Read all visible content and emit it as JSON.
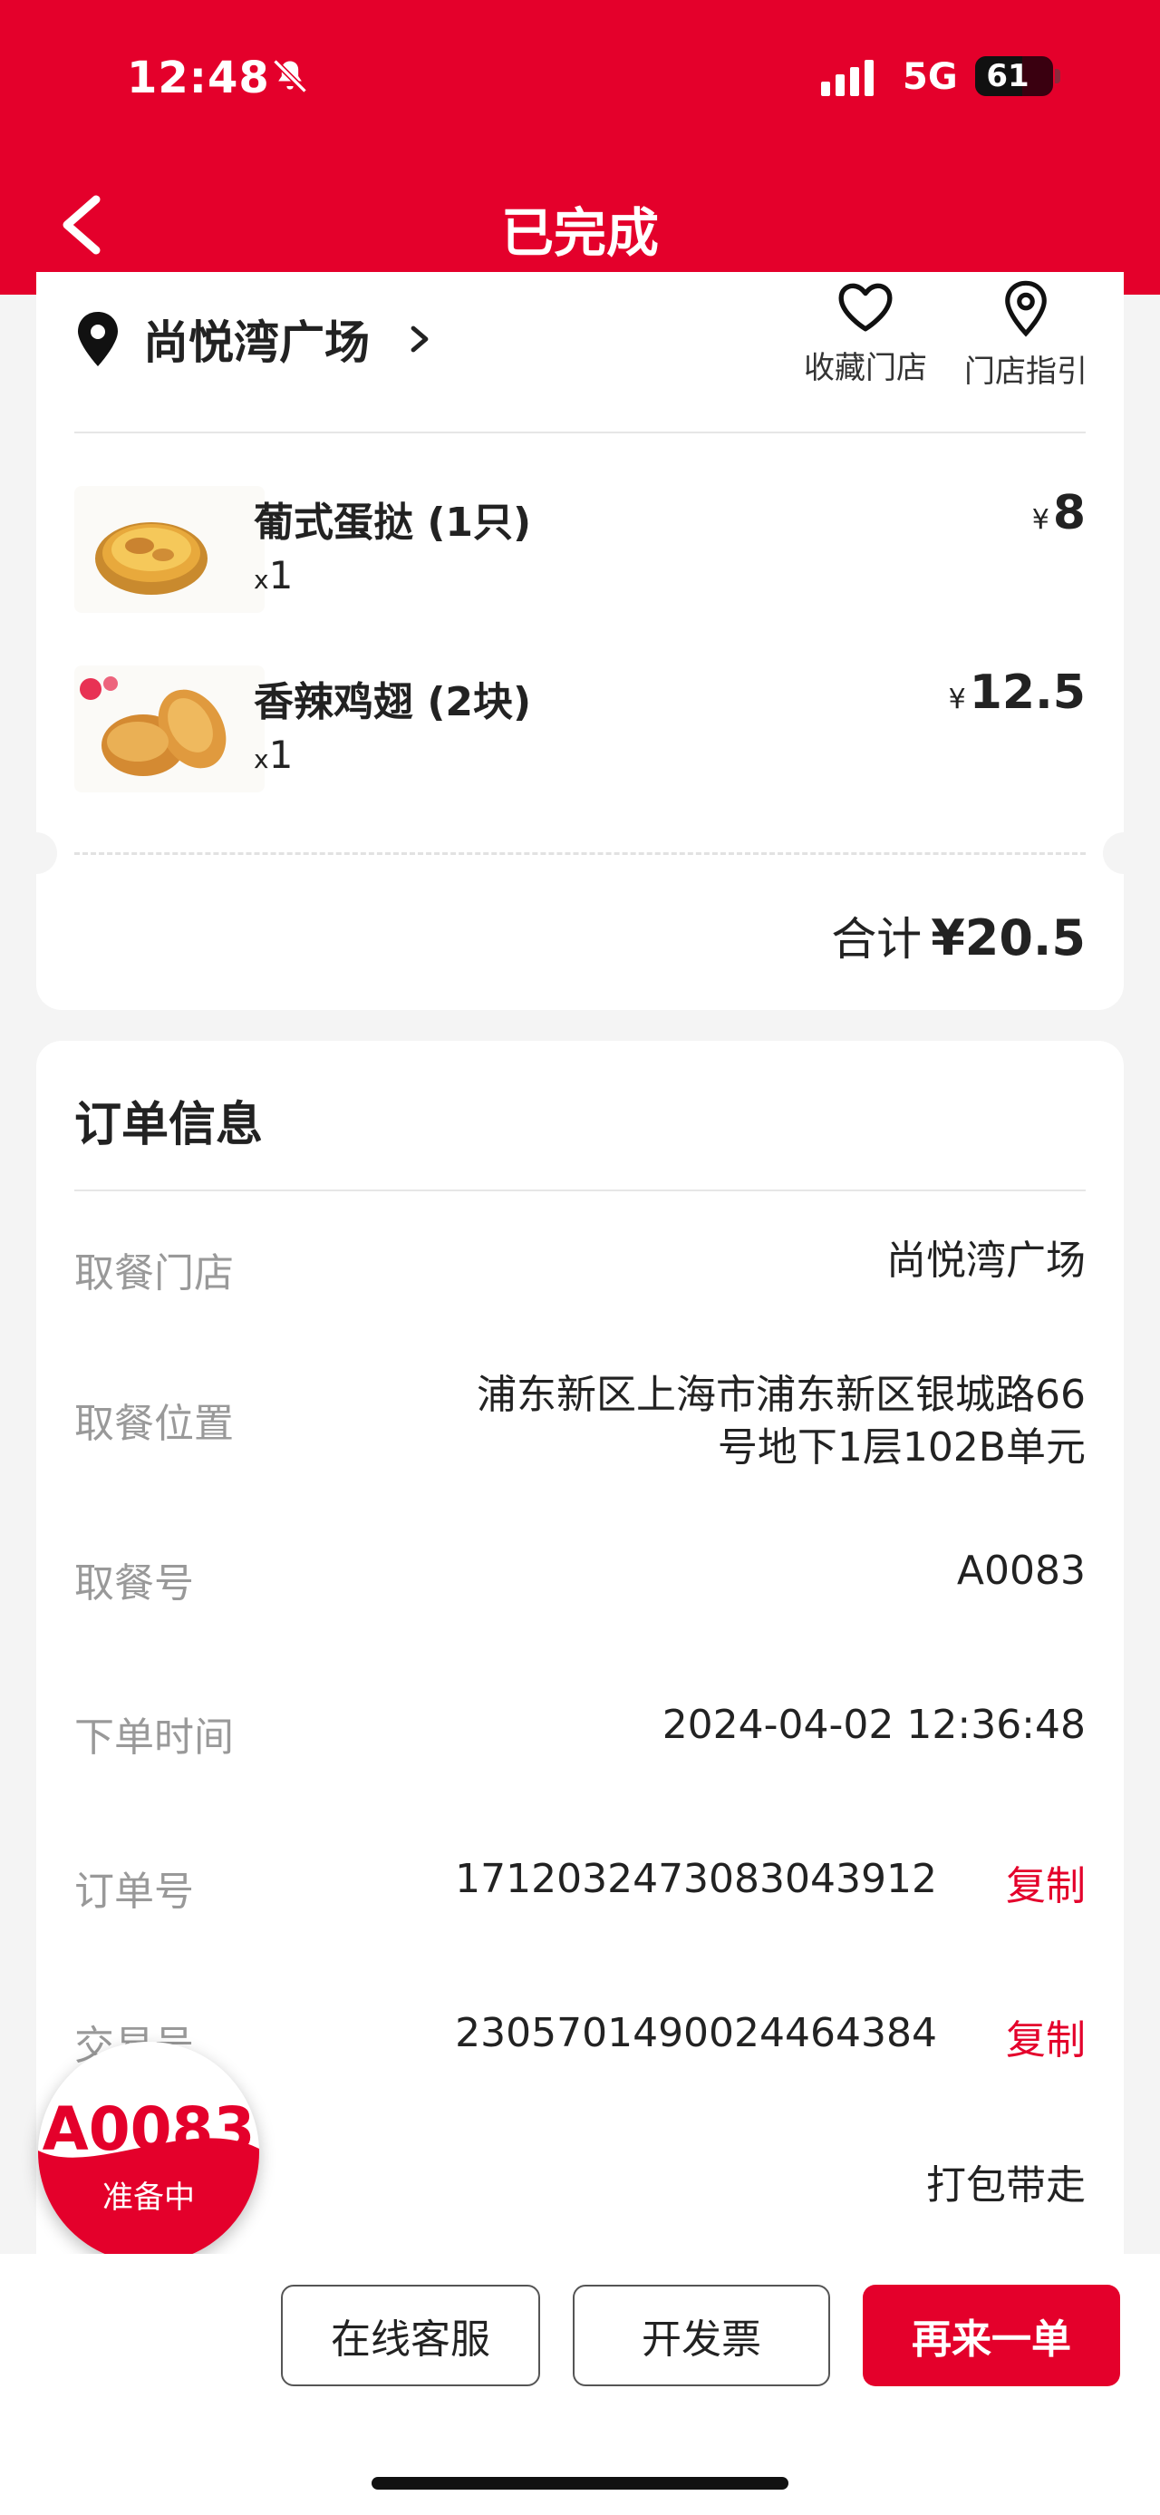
{
  "status_bar": {
    "time": "12:48",
    "network": "5G",
    "battery": "61",
    "battery_level_pct": 61
  },
  "nav": {
    "title": "已完成"
  },
  "store": {
    "name": "尚悦湾广场",
    "favorite_label": "收藏门店",
    "guide_label": "门店指引"
  },
  "items": [
    {
      "name": "葡式蛋挞 (1只)",
      "qty_prefix": "x",
      "qty": "1",
      "currency": "¥",
      "price": "8"
    },
    {
      "name": "香辣鸡翅 (2块)",
      "qty_prefix": "x",
      "qty": "1",
      "currency": "¥",
      "price": "12.5"
    }
  ],
  "summary": {
    "total_label": "合计",
    "total_amount": "¥20.5"
  },
  "order_info": {
    "title": "订单信息",
    "rows": [
      {
        "label": "取餐门店",
        "value": "尚悦湾广场"
      },
      {
        "label": "取餐位置",
        "value_line1": "浦东新区上海市浦东新区银城路66",
        "value_line2": "号地下1层102B单元"
      },
      {
        "label": "取餐号",
        "value": "A0083"
      },
      {
        "label": "下单时间",
        "value": "2024-04-02 12:36:48"
      },
      {
        "label": "订单号",
        "value": "1712032473083043912",
        "action": "复制"
      },
      {
        "label": "交易号",
        "value": "2305701490024464384",
        "action": "复制"
      },
      {
        "label": "",
        "value": "打包带走"
      }
    ]
  },
  "floating_badge": {
    "number": "A0083",
    "status": "准备中"
  },
  "actions": {
    "service": "在线客服",
    "invoice": "开发票",
    "reorder": "再来一单"
  },
  "colors": {
    "brand": "#e4002b",
    "background": "#f4f4f4"
  }
}
